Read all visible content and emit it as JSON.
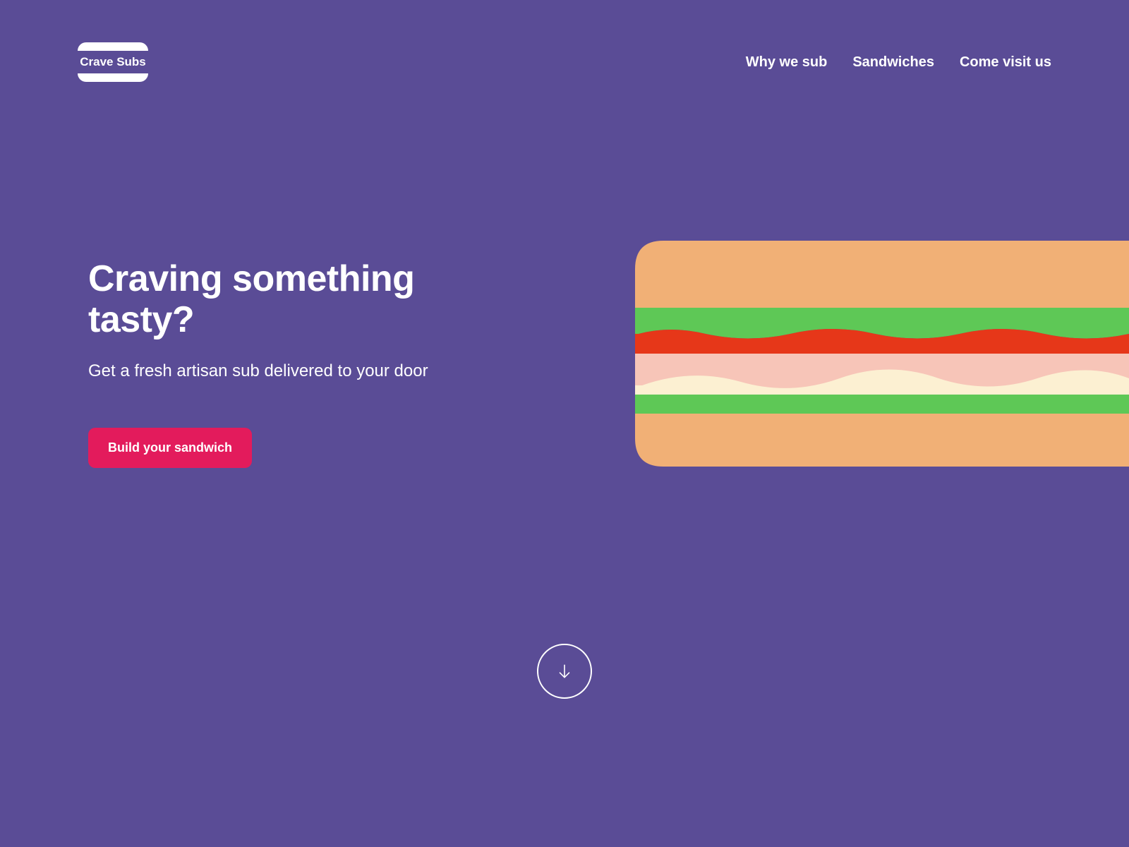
{
  "brand": {
    "name": "Crave Subs"
  },
  "nav": {
    "items": [
      {
        "label": "Why we sub"
      },
      {
        "label": "Sandwiches"
      },
      {
        "label": "Come visit us"
      }
    ]
  },
  "hero": {
    "title": "Craving something tasty?",
    "subtitle": "Get a fresh artisan sub delivered to your door",
    "cta": "Build your sandwich"
  },
  "colors": {
    "background": "#5a4c96",
    "accent": "#e31b5c",
    "bread": "#f1b076",
    "lettuce": "#5ec856",
    "tomato": "#e63719",
    "meat": "#f7c5b8",
    "cheese": "#fcf0d2"
  }
}
